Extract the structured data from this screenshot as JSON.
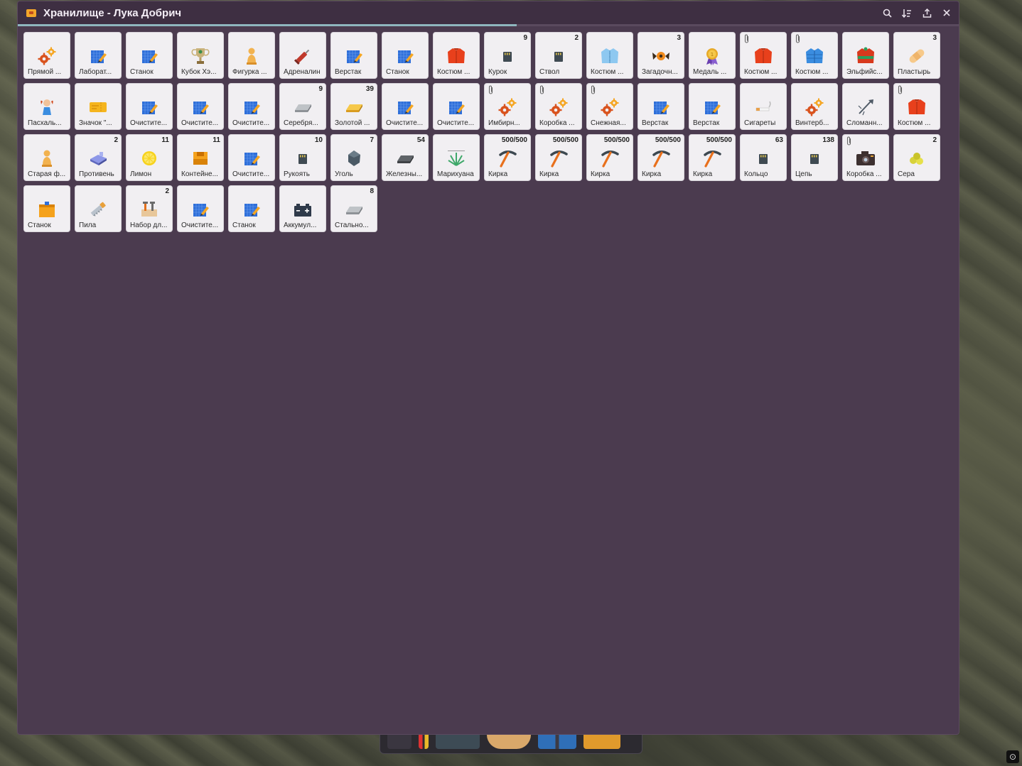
{
  "window": {
    "title": "Хранилище - Лука Добрич",
    "capacity_fraction": 0.53
  },
  "items": [
    {
      "label": "Прямой ...",
      "icon": "gears-icon",
      "count": "",
      "clip": false
    },
    {
      "label": "Лаборат...",
      "icon": "blueprint-icon",
      "count": "",
      "clip": false
    },
    {
      "label": "Станок",
      "icon": "blueprint-icon",
      "count": "",
      "clip": false
    },
    {
      "label": "Кубок Хэ...",
      "icon": "trophy-icon",
      "count": "",
      "clip": false
    },
    {
      "label": "Фигурка ...",
      "icon": "figurine-icon",
      "count": "",
      "clip": false
    },
    {
      "label": "Адреналин",
      "icon": "syringe-icon",
      "count": "",
      "clip": false
    },
    {
      "label": "Верстак",
      "icon": "blueprint-icon",
      "count": "",
      "clip": false
    },
    {
      "label": "Станок",
      "icon": "blueprint-icon",
      "count": "",
      "clip": false
    },
    {
      "label": "Костюм ...",
      "icon": "red-jacket-icon",
      "count": "",
      "clip": false
    },
    {
      "label": "Курок",
      "icon": "chip-icon",
      "count": "9",
      "clip": false
    },
    {
      "label": "Ствол",
      "icon": "chip-icon",
      "count": "2",
      "clip": false
    },
    {
      "label": "Костюм ...",
      "icon": "shirt-icon",
      "count": "",
      "clip": false
    },
    {
      "label": "Загадочн...",
      "icon": "candy-icon",
      "count": "3",
      "clip": false
    },
    {
      "label": "Медаль ...",
      "icon": "medal-icon",
      "count": "",
      "clip": false
    },
    {
      "label": "Костюм ...",
      "icon": "red-jacket-icon",
      "count": "",
      "clip": true
    },
    {
      "label": "Костюм ...",
      "icon": "blue-jacket-icon",
      "count": "",
      "clip": true
    },
    {
      "label": "Эльфийс...",
      "icon": "elf-costume-icon",
      "count": "",
      "clip": false
    },
    {
      "label": "Пластырь",
      "icon": "bandage-icon",
      "count": "3",
      "clip": false
    },
    {
      "label": "Пасхаль...",
      "icon": "doll-icon",
      "count": "",
      "clip": false
    },
    {
      "label": "Значок \"...",
      "icon": "ticket-icon",
      "count": "",
      "clip": false
    },
    {
      "label": "Очистите...",
      "icon": "blueprint-icon",
      "count": "",
      "clip": false
    },
    {
      "label": "Очистите...",
      "icon": "blueprint-icon",
      "count": "",
      "clip": false
    },
    {
      "label": "Очистите...",
      "icon": "blueprint-icon",
      "count": "",
      "clip": false
    },
    {
      "label": "Серебря...",
      "icon": "silver-ingot-icon",
      "count": "9",
      "clip": false
    },
    {
      "label": "Золотой ...",
      "icon": "gold-ingot-icon",
      "count": "39",
      "clip": false
    },
    {
      "label": "Очистите...",
      "icon": "blueprint-icon",
      "count": "",
      "clip": false
    },
    {
      "label": "Очистите...",
      "icon": "blueprint-icon",
      "count": "",
      "clip": false
    },
    {
      "label": "Имбирн...",
      "icon": "gears-icon",
      "count": "",
      "clip": true
    },
    {
      "label": "Коробка ...",
      "icon": "gears-icon",
      "count": "",
      "clip": true
    },
    {
      "label": "Снежная...",
      "icon": "gears-icon",
      "count": "",
      "clip": true
    },
    {
      "label": "Верстак",
      "icon": "blueprint-icon",
      "count": "",
      "clip": false
    },
    {
      "label": "Верстак",
      "icon": "blueprint-icon",
      "count": "",
      "clip": false
    },
    {
      "label": "Сигареты",
      "icon": "cigarette-icon",
      "count": "",
      "clip": false
    },
    {
      "label": "Винтерб...",
      "icon": "gears-icon",
      "count": "",
      "clip": false
    },
    {
      "label": "Сломанн...",
      "icon": "broken-item-icon",
      "count": "",
      "clip": false
    },
    {
      "label": "Костюм ...",
      "icon": "red-jacket-icon",
      "count": "",
      "clip": true
    },
    {
      "label": "Старая ф...",
      "icon": "figurine-icon",
      "count": "",
      "clip": false
    },
    {
      "label": "Противень",
      "icon": "tray-icon",
      "count": "2",
      "clip": false
    },
    {
      "label": "Лимон",
      "icon": "lemon-icon",
      "count": "11",
      "clip": false
    },
    {
      "label": "Контейне...",
      "icon": "container-icon",
      "count": "11",
      "clip": false
    },
    {
      "label": "Очистите...",
      "icon": "blueprint-icon",
      "count": "",
      "clip": false
    },
    {
      "label": "Рукоять",
      "icon": "chip-icon",
      "count": "10",
      "clip": false
    },
    {
      "label": "Уголь",
      "icon": "coal-icon",
      "count": "7",
      "clip": false
    },
    {
      "label": "Железны...",
      "icon": "iron-ingot-icon",
      "count": "54",
      "clip": false
    },
    {
      "label": "Марихуана",
      "icon": "plant-icon",
      "count": "",
      "clip": false
    },
    {
      "label": "Кирка",
      "icon": "pickaxe-icon",
      "count": "500/500",
      "clip": false
    },
    {
      "label": "Кирка",
      "icon": "pickaxe-icon",
      "count": "500/500",
      "clip": false
    },
    {
      "label": "Кирка",
      "icon": "pickaxe-icon",
      "count": "500/500",
      "clip": false
    },
    {
      "label": "Кирка",
      "icon": "pickaxe-icon",
      "count": "500/500",
      "clip": false
    },
    {
      "label": "Кирка",
      "icon": "pickaxe-icon",
      "count": "500/500",
      "clip": false
    },
    {
      "label": "Кольцо",
      "icon": "chip-icon",
      "count": "63",
      "clip": false
    },
    {
      "label": "Цепь",
      "icon": "chip-icon",
      "count": "138",
      "clip": false
    },
    {
      "label": "Коробка ...",
      "icon": "camera-icon",
      "count": "",
      "clip": true
    },
    {
      "label": "Сера",
      "icon": "sulfur-icon",
      "count": "2",
      "clip": false
    },
    {
      "label": "Станок",
      "icon": "orange-box-icon",
      "count": "",
      "clip": false
    },
    {
      "label": "Пила",
      "icon": "saw-icon",
      "count": "",
      "clip": false
    },
    {
      "label": "Набор дл...",
      "icon": "toolkit-icon",
      "count": "2",
      "clip": false
    },
    {
      "label": "Очистите...",
      "icon": "blueprint-icon",
      "count": "",
      "clip": false
    },
    {
      "label": "Станок",
      "icon": "blueprint-icon",
      "count": "",
      "clip": false
    },
    {
      "label": "Аккумул...",
      "icon": "battery-icon",
      "count": "",
      "clip": false
    },
    {
      "label": "Стально...",
      "icon": "silver-ingot-icon",
      "count": "8",
      "clip": false
    }
  ]
}
